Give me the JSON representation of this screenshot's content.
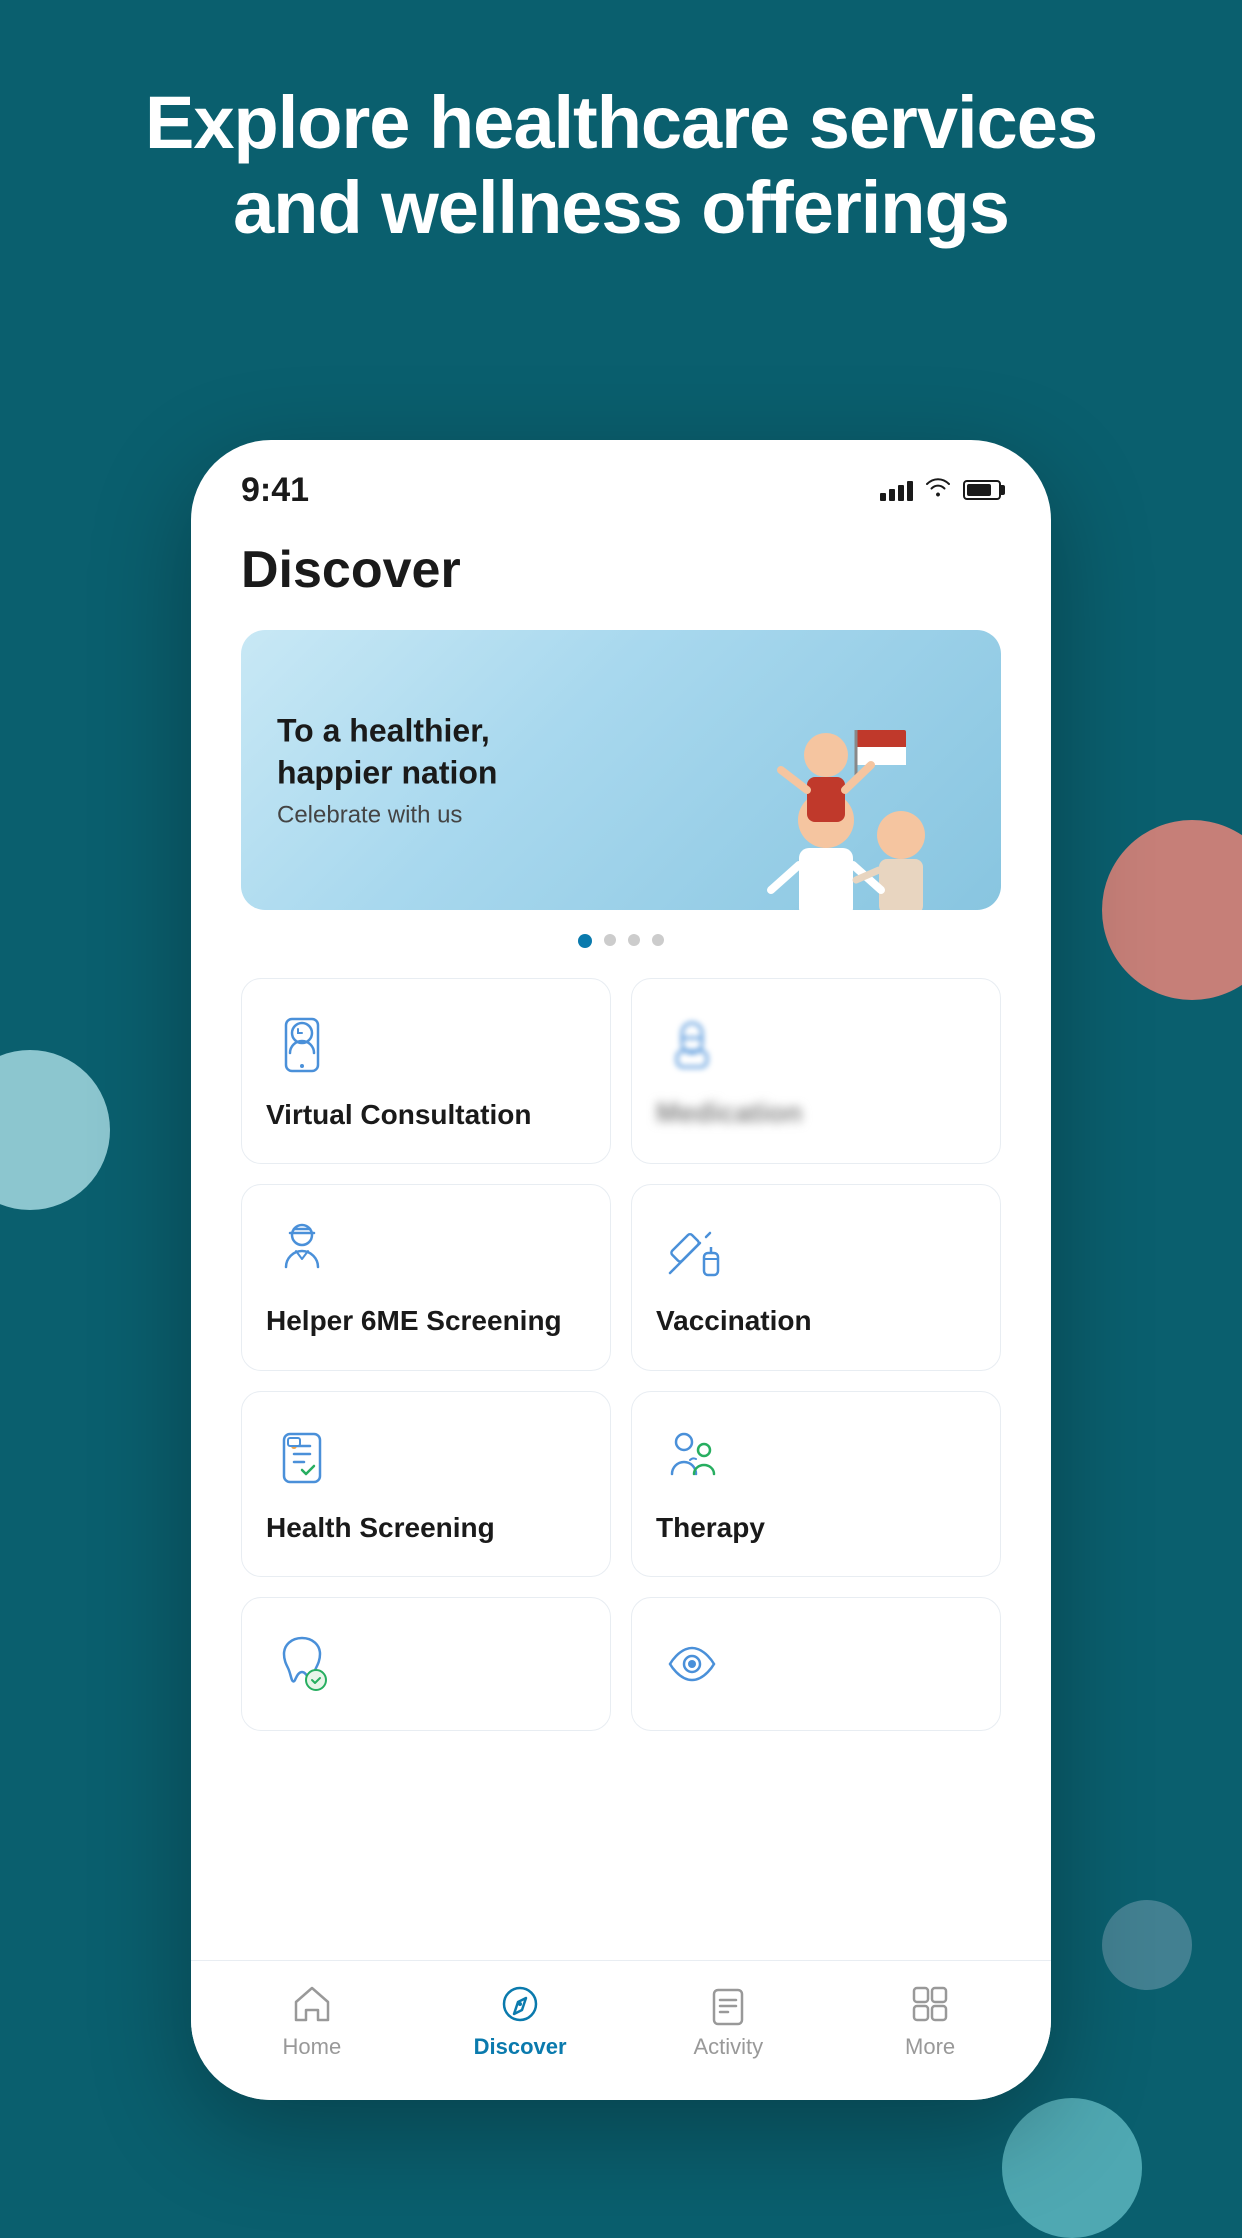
{
  "background": {
    "color": "#0a5f6e"
  },
  "header": {
    "title": "Explore healthcare services and wellness offerings"
  },
  "status_bar": {
    "time": "9:41",
    "signal": "signal-icon",
    "wifi": "wifi-icon",
    "battery": "battery-icon"
  },
  "page": {
    "title": "Discover"
  },
  "banner": {
    "title": "To a healthier,\nhappier nation",
    "subtitle": "Celebrate with us",
    "dots": [
      true,
      false,
      false,
      false
    ]
  },
  "services": [
    {
      "id": "virtual-consultation",
      "label": "Virtual Consultation",
      "icon": "phone-doctor-icon"
    },
    {
      "id": "medication",
      "label": "",
      "icon": "medication-icon",
      "blurred": true
    },
    {
      "id": "helper-screening",
      "label": "Helper 6ME Screening",
      "icon": "helper-icon"
    },
    {
      "id": "vaccination",
      "label": "Vaccination",
      "icon": "vaccination-icon"
    },
    {
      "id": "health-screening",
      "label": "Health Screening",
      "icon": "health-screening-icon"
    },
    {
      "id": "therapy",
      "label": "Therapy",
      "icon": "therapy-icon"
    },
    {
      "id": "dental",
      "label": "",
      "icon": "dental-icon"
    },
    {
      "id": "eye",
      "label": "",
      "icon": "eye-icon"
    }
  ],
  "bottom_nav": [
    {
      "id": "home",
      "label": "Home",
      "active": false
    },
    {
      "id": "discover",
      "label": "Discover",
      "active": true
    },
    {
      "id": "activity",
      "label": "Activity",
      "active": false
    },
    {
      "id": "more",
      "label": "More",
      "active": false
    }
  ]
}
